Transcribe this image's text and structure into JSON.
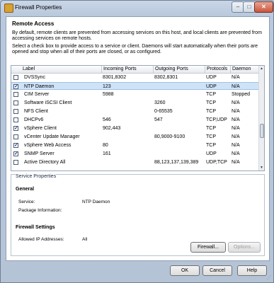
{
  "window": {
    "title": "Firewall Properties",
    "controls": {
      "minimize": "–",
      "maximize": "□",
      "close": "✕"
    }
  },
  "remote_access": {
    "heading": "Remote Access",
    "description1": "By default, remote clients are prevented from accessing services on this host, and local clients are prevented from accessing services on remote hosts.",
    "description2": "Select a check box to provide access to a service or client. Daemons will start automatically when their ports are opened and stop when all of their ports are closed, or as configured."
  },
  "table": {
    "columns": [
      "Label",
      "Incoming Ports",
      "Outgoing Ports",
      "Protocols",
      "Daemon"
    ],
    "rows": [
      {
        "checked": false,
        "label": "DVSSync",
        "incoming": "8301,8302",
        "outgoing": "8302,8301",
        "protocols": "UDP",
        "daemon": "N/A",
        "selected": false
      },
      {
        "checked": true,
        "label": "NTP Daemon",
        "incoming": "123",
        "outgoing": "",
        "protocols": "UDP",
        "daemon": "N/A",
        "selected": true
      },
      {
        "checked": false,
        "label": "CIM Server",
        "incoming": "5988",
        "outgoing": "",
        "protocols": "TCP",
        "daemon": "Stopped",
        "selected": false
      },
      {
        "checked": false,
        "label": "Software iSCSI Client",
        "incoming": "",
        "outgoing": "3260",
        "protocols": "TCP",
        "daemon": "N/A",
        "selected": false
      },
      {
        "checked": false,
        "label": "NFS Client",
        "incoming": "",
        "outgoing": "0-65535",
        "protocols": "TCP",
        "daemon": "N/A",
        "selected": false
      },
      {
        "checked": false,
        "label": "DHCPv6",
        "incoming": "546",
        "outgoing": "547",
        "protocols": "TCP,UDP",
        "daemon": "N/A",
        "selected": false
      },
      {
        "checked": true,
        "label": "vSphere Client",
        "incoming": "902,443",
        "outgoing": "",
        "protocols": "TCP",
        "daemon": "N/A",
        "selected": false
      },
      {
        "checked": false,
        "label": "vCenter Update Manager",
        "incoming": "",
        "outgoing": "80,9000-9100",
        "protocols": "TCP",
        "daemon": "N/A",
        "selected": false
      },
      {
        "checked": true,
        "label": "vSphere Web Access",
        "incoming": "80",
        "outgoing": "",
        "protocols": "TCP",
        "daemon": "N/A",
        "selected": false
      },
      {
        "checked": true,
        "label": "SNMP Server",
        "incoming": "161",
        "outgoing": "",
        "protocols": "UDP",
        "daemon": "N/A",
        "selected": false
      },
      {
        "checked": false,
        "label": "Active Directory All",
        "incoming": "",
        "outgoing": "88,123,137,139,389",
        "protocols": "UDP,TCP",
        "daemon": "N/A",
        "selected": false
      }
    ]
  },
  "service_properties": {
    "group_label": "Service Properties",
    "general_heading": "General",
    "service_label": "Service:",
    "service_value": "NTP Daemon",
    "package_label": "Package Information:",
    "package_value": "",
    "firewall_heading": "Firewall Settings",
    "allowed_label": "Allowed IP Addresses:",
    "allowed_value": "All",
    "firewall_button": "Firewall...",
    "options_button": "Options..."
  },
  "footer": {
    "ok": "OK",
    "cancel": "Cancel",
    "help": "Help"
  },
  "icons": {
    "app": "firewall-icon",
    "check": "✓",
    "scroll_up": "▲",
    "scroll_down": "▼",
    "grip": "⋰"
  }
}
